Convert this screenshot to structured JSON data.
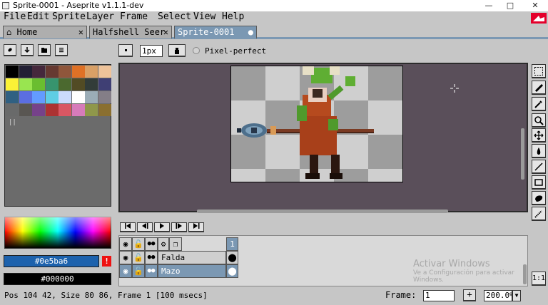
{
  "window": {
    "title": "Sprite-0001 - Aseprite v1.1.1-dev",
    "minimize": "—",
    "maximize": "□",
    "close": "✕"
  },
  "menu": [
    "File",
    "Edit",
    "Sprite",
    "Layer",
    "Frame",
    "Select",
    "View",
    "Help"
  ],
  "tabs": [
    {
      "label": "Home",
      "icon": "home-icon",
      "glyph": "⌂",
      "close": "✕"
    },
    {
      "label": "Halfshell Seer",
      "close": "✕"
    },
    {
      "label": "Sprite-0001",
      "close": "●"
    }
  ],
  "toolbar": {
    "brush_size": "1px",
    "pixel_perfect_label": "Pixel-perfect"
  },
  "palette": {
    "colors": [
      "#000000",
      "#222034",
      "#45283c",
      "#663931",
      "#8f563b",
      "#df7126",
      "#d9a066",
      "#eec39a",
      "#fbf236",
      "#99e550",
      "#6abe30",
      "#37946e",
      "#4b692f",
      "#524b24",
      "#323c39",
      "#3f3f74",
      "#306082",
      "#5b6ee1",
      "#639bff",
      "#5fcde4",
      "#cbdbfc",
      "#ffffff",
      "#9badb7",
      "#847e87",
      "#696a6a",
      "#595652",
      "#76428a",
      "#ac3232",
      "#d95763",
      "#d77bba",
      "#8f974a",
      "#8a6f30"
    ]
  },
  "colors": {
    "foreground_hex": "#0e5ba6",
    "background_hex": "#000000",
    "fg_swatch": "#1d62ad",
    "bg_swatch": "#000000"
  },
  "timeline": {
    "frame_number": "1",
    "layers": [
      {
        "name": "Falda",
        "selected": false
      },
      {
        "name": "Mazo",
        "selected": true
      }
    ]
  },
  "watermark": {
    "title": "Activar Windows",
    "subtitle": "Ve a Configuración para activar",
    "subtitle2": "Windows."
  },
  "status": {
    "text": "Pos 104 42, Size 80 86, Frame 1 [100 msecs]",
    "frame_label": "Frame:",
    "frame_value": "1",
    "add_frame": "+",
    "zoom": "200.0%"
  },
  "ratio_label": "1:1"
}
